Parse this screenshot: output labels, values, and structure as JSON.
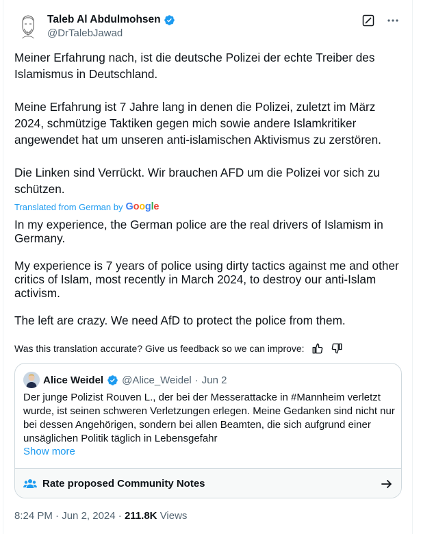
{
  "author": {
    "name": "Taleb Al Abdulmohsen",
    "handle": "@DrTalebJawad"
  },
  "post": {
    "paragraphs": [
      "Meiner Erfahrung nach, ist die deutsche Polizei der echte Treiber des Islamismus in Deutschland.",
      "Meine Erfahrung ist 7 Jahre lang in denen die Polizei, zuletzt im März 2024, schmützige Taktiken gegen mich sowie andere Islamkritiker angewendet hat um unseren anti-islamischen Aktivismus zu zerstören.",
      "Die Linken sind Verrückt. Wir brauchen AFD um die Polizei vor sich zu schützen."
    ],
    "translated_label": "Translated from German by",
    "translator": "Google",
    "translation": [
      "In my experience, the German police are the real drivers of Islamism in Germany.",
      "My experience is 7 years of police using dirty tactics against me and other critics of Islam, most recently in March 2024, to destroy our anti-Islam activism.",
      "The left are crazy. We need AfD to protect the police from them."
    ],
    "feedback_text": "Was this translation accurate? Give us feedback so we can improve:"
  },
  "quote": {
    "name": "Alice Weidel",
    "handle": "@Alice_Weidel",
    "separator": "·",
    "date": "Jun 2",
    "text": "Der junge Polizist Rouven L., der bei der Messerattacke in #Mannheim verletzt wurde, ist seinen schweren Verletzungen erlegen. Meine Gedanken sind nicht nur bei dessen Angehörigen, sondern bei allen Beamten, die sich aufgrund einer unsäglichen Politik täglich in Lebensgefahr",
    "show_more": "Show more",
    "notes_label": "Rate proposed Community Notes"
  },
  "meta": {
    "time": "8:24 PM",
    "separator": "·",
    "date": "Jun 2, 2024",
    "views_count": "211.8K",
    "views_label": "Views"
  },
  "colors": {
    "accent": "#1d9bf0",
    "text": "#0f1419",
    "secondary": "#536471",
    "border": "#cfd9de"
  },
  "icons": [
    "verified-badge-icon",
    "grok-icon",
    "more-icon",
    "thumbs-up-icon",
    "thumbs-down-icon",
    "people-icon",
    "arrow-right-icon"
  ]
}
